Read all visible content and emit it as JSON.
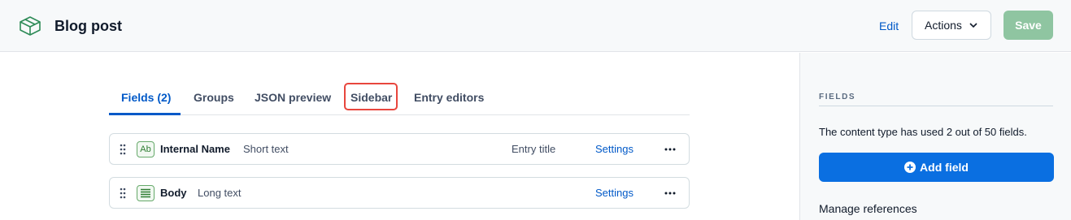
{
  "header": {
    "title": "Blog post",
    "logo_icon": "content-type-icon",
    "edit_label": "Edit",
    "actions_label": "Actions",
    "save_label": "Save"
  },
  "tabs": [
    {
      "label": "Fields (2)",
      "active": true
    },
    {
      "label": "Groups",
      "active": false
    },
    {
      "label": "JSON preview",
      "active": false
    },
    {
      "label": "Sidebar",
      "active": false,
      "highlighted": true
    },
    {
      "label": "Entry editors",
      "active": false
    }
  ],
  "fields": [
    {
      "type_icon": "short-text-icon",
      "icon_text": "Ab",
      "name": "Internal Name",
      "type": "Short text",
      "badge": "Entry title",
      "settings_label": "Settings"
    },
    {
      "type_icon": "long-text-icon",
      "icon_text": "",
      "name": "Body",
      "type": "Long text",
      "badge": "",
      "settings_label": "Settings"
    }
  ],
  "sidebar": {
    "heading": "FIELDS",
    "usage_text": "The content type has used 2 out of 50 fields.",
    "add_field_label": "Add field",
    "manage_refs_label": "Manage references"
  },
  "colors": {
    "primary": "#0059c8",
    "save_disabled": "#8fc5a1",
    "highlight": "#e8463d",
    "field_icon": "#66a96a"
  }
}
